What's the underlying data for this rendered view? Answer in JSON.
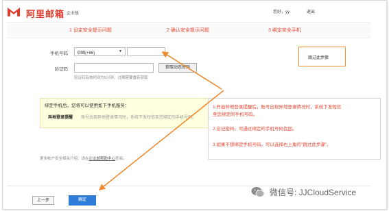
{
  "header": {
    "logo_text": "阿里邮箱",
    "edition": "企业版",
    "greeting": "您好，yy",
    "logout": "退出"
  },
  "steps": [
    {
      "label": "1 设定安全提示问题"
    },
    {
      "label": "2 确认安全提示问题"
    },
    {
      "label": "3 绑定安全手机"
    }
  ],
  "form": {
    "phone_label": "手机号码",
    "country_value": "中国(+86)",
    "code_label": "验证码",
    "get_code_button": "获取动态密码",
    "hint": "验证码有效时间为5分钟，过期需要重新获取"
  },
  "skip": {
    "label": "跳过此步骤"
  },
  "services": {
    "title": "绑定手机后，您将可以使用如下手机服务：",
    "item_name": "异地登录提醒",
    "item_desc": "账号出现异地登录情况时，系统下发短信至您绑定的手机号码。"
  },
  "annotations": {
    "line1": "1.开启异地登录提醒后，账号出现异地登录情况时，系统下发短信",
    "line2": "至您绑定的手机号码。",
    "line3": "2.忘记密码，可通过绑定的手机号码找回。",
    "line4": "3.如果不想绑定手机号码，可以选择右上角的\"跳过此步骤\"。"
  },
  "footer": {
    "more_prefix": "更多帐户安全相关介绍：请在",
    "more_link": "企业邮帮助中心",
    "more_suffix": "查阅。",
    "prev_button": "上一步",
    "ok_button": "确定"
  },
  "watermark": {
    "text": "微信号: JJCloudService",
    "icon": "wechat-icon"
  },
  "colors": {
    "brand_red": "#e13b2b",
    "step_red": "#e8452f",
    "arrow_orange": "#f08b2e",
    "primary_blue": "#2f7cd8"
  }
}
